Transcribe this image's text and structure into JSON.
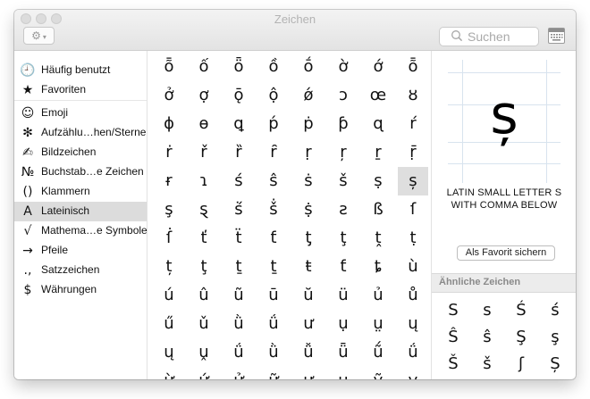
{
  "window": {
    "title": "Zeichen"
  },
  "toolbar": {
    "action_icon": "gear-icon",
    "search_placeholder": "Suchen",
    "viewer_icon": "keyboard-viewer-icon"
  },
  "sidebar": {
    "items": [
      {
        "icon": "🕘",
        "label": "Häufig benutzt"
      },
      {
        "icon": "★",
        "label": "Favoriten"
      },
      {
        "icon": "☺",
        "label": "Emoji"
      },
      {
        "icon": "✻",
        "label": "Aufzählu…hen/Sterne"
      },
      {
        "icon": "✍",
        "label": "Bildzeichen"
      },
      {
        "icon": "№",
        "label": "Buchstab…e Zeichen"
      },
      {
        "icon": "()",
        "label": "Klammern"
      },
      {
        "icon": "A",
        "label": "Lateinisch"
      },
      {
        "icon": "√",
        "label": "Mathema…e Symbole"
      },
      {
        "icon": "→",
        "label": "Pfeile"
      },
      {
        "icon": ".,",
        "label": "Satzzeichen"
      },
      {
        "icon": "$",
        "label": "Währungen"
      }
    ],
    "selected_index": 7
  },
  "grid": {
    "rows": [
      [
        "ȭ",
        "ố",
        "ȫ",
        "ồ",
        "ṓ",
        "ờ",
        "ớ",
        "ȭ"
      ],
      [
        "ở",
        "ợ",
        "ǭ",
        "ộ",
        "ǿ",
        "ɔ",
        "œ",
        "ȣ"
      ],
      [
        "ɸ",
        "ɵ",
        "ꝗ",
        "ṕ",
        "ṗ",
        "ƥ",
        "ɋ",
        "ŕ"
      ],
      [
        "ṙ",
        "ř",
        "ȑ",
        "ȓ",
        "ṛ",
        "ŗ",
        "ṟ",
        "ṝ"
      ],
      [
        "ɍ",
        "ɿ",
        "ś",
        "ŝ",
        "ṡ",
        "š",
        "ṣ",
        "ș"
      ],
      [
        "ş",
        "ȿ",
        "ṥ",
        "ṧ",
        "ṩ",
        "ƨ",
        "ß",
        "ſ"
      ],
      [
        "ẛ",
        "ť",
        "ẗ",
        "ƭ",
        "ƫ",
        "ţ",
        "ṱ",
        "ṭ"
      ],
      [
        "ț",
        "ţ",
        "ṯ",
        "ṯ",
        "ŧ",
        "ƭ",
        "ȶ",
        "ù"
      ],
      [
        "ú",
        "û",
        "ũ",
        "ū",
        "ŭ",
        "ü",
        "ủ",
        "ů"
      ],
      [
        "ű",
        "ǔ",
        "ǜ",
        "ǘ",
        "ư",
        "ụ",
        "ṳ",
        "ų"
      ],
      [
        "ų",
        "ṷ",
        "ǘ",
        "ǜ",
        "ǚ",
        "ǖ",
        "ṹ",
        "ǘ"
      ],
      [
        "ừ",
        "ứ",
        "ử",
        "ữ",
        "ự",
        "ʉ",
        "ṽ",
        "ṿ"
      ]
    ],
    "selected_char": "ș"
  },
  "detail": {
    "glyph": "ș",
    "name": "LATIN SMALL LETTER S WITH COMMA BELOW",
    "favorite_button": "Als Favorit sichern",
    "similar_heading": "Ähnliche Zeichen",
    "similar": [
      "S",
      "s",
      "Ś",
      "ś",
      "Ŝ",
      "ŝ",
      "Ş",
      "ş",
      "Š",
      "š",
      "ʃ",
      "Ș"
    ]
  }
}
